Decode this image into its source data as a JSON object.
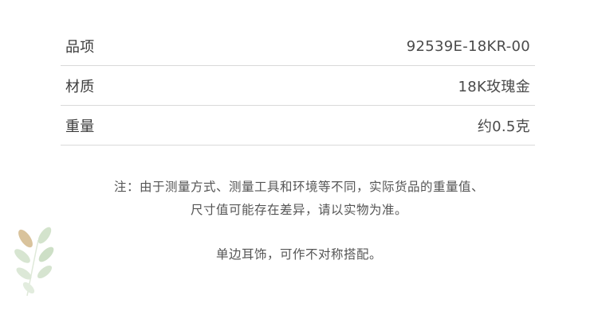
{
  "specs": [
    {
      "label": "品项",
      "value": "92539E-18KR-00"
    },
    {
      "label": "材质",
      "value": "18K玫瑰金"
    },
    {
      "label": "重量",
      "value": "约0.5克"
    }
  ],
  "notes": {
    "disclaimer_line1": "注：由于测量方式、测量工具和环境等不同，实际货品的重量值、",
    "disclaimer_line2": "尺寸值可能存在差异，请以实物为准。",
    "single_earring": "单边耳饰，可作不对称搭配。"
  },
  "colors": {
    "leaf_tan": "#d9c39c",
    "leaf_green": "#c9dcc1",
    "divider": "#d9d9d9"
  }
}
